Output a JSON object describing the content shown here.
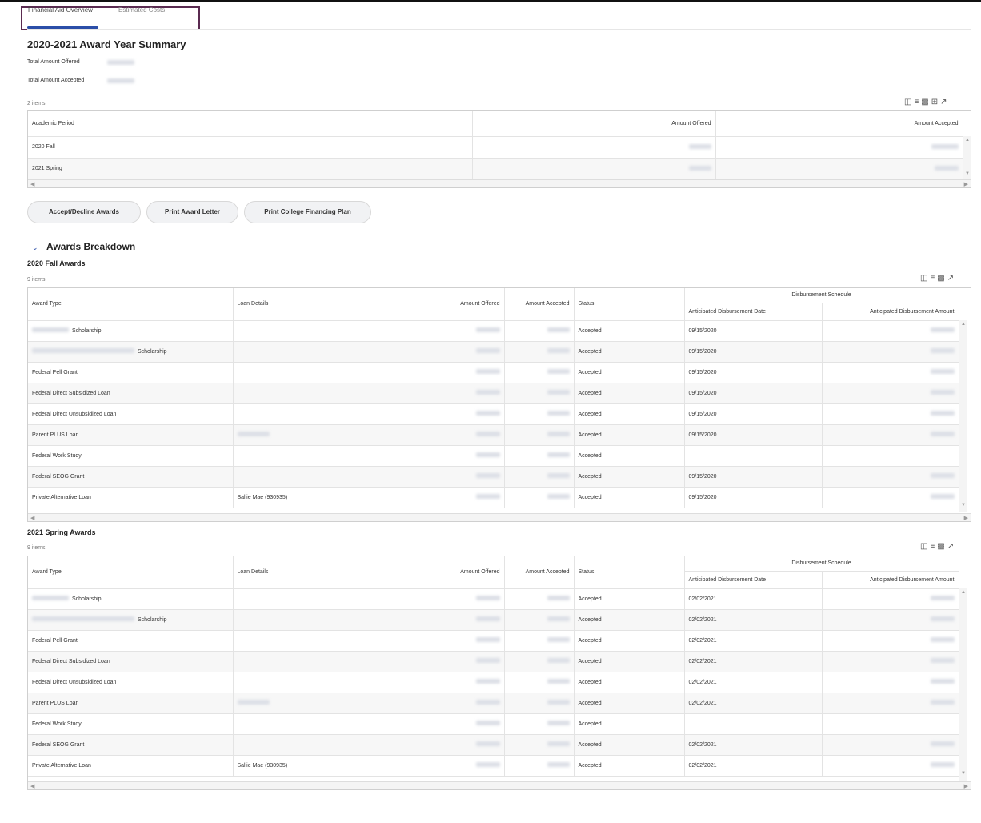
{
  "tabs": [
    "Financial Aid Overview",
    "Estimated Costs"
  ],
  "summary": {
    "title": "2020-2021 Award Year Summary",
    "total_offered_label": "Total Amount Offered",
    "total_accepted_label": "Total Amount Accepted"
  },
  "period_table": {
    "count": "2 items",
    "headers": [
      "Academic Period",
      "Amount Offered",
      "Amount Accepted"
    ],
    "rows": [
      {
        "period": "2020 Fall"
      },
      {
        "period": "2021 Spring"
      }
    ]
  },
  "buttons": {
    "accept": "Accept/Decline Awards",
    "letter": "Print Award Letter",
    "plan": "Print College Financing Plan"
  },
  "breakdown": {
    "title": "Awards Breakdown",
    "headers": {
      "award_type": "Award Type",
      "loan_details": "Loan Details",
      "amount_offered": "Amount Offered",
      "amount_accepted": "Amount Accepted",
      "status": "Status",
      "schedule": "Disbursement Schedule",
      "date": "Anticipated Disbursement Date",
      "amount": "Anticipated Disbursement Amount"
    },
    "fall": {
      "title": "2020 Fall Awards",
      "count": "9 items",
      "rows": [
        {
          "type": "Scholarship",
          "loan": "",
          "status": "Accepted",
          "date": "09/15/2020"
        },
        {
          "type": "Scholarship",
          "loan": "",
          "status": "Accepted",
          "date": "09/15/2020"
        },
        {
          "type": "Federal Pell Grant",
          "loan": "",
          "status": "Accepted",
          "date": "09/15/2020"
        },
        {
          "type": "Federal Direct Subsidized Loan",
          "loan": "",
          "status": "Accepted",
          "date": "09/15/2020"
        },
        {
          "type": "Federal Direct Unsubsidized Loan",
          "loan": "",
          "status": "Accepted",
          "date": "09/15/2020"
        },
        {
          "type": "Parent PLUS Loan",
          "loan": "",
          "status": "Accepted",
          "date": "09/15/2020"
        },
        {
          "type": "Federal Work Study",
          "loan": "",
          "status": "Accepted",
          "date": ""
        },
        {
          "type": "Federal SEOG Grant",
          "loan": "",
          "status": "Accepted",
          "date": "09/15/2020"
        },
        {
          "type": "Private Alternative Loan",
          "loan": "Sallie Mae (930935)",
          "status": "Accepted",
          "date": "09/15/2020"
        }
      ]
    },
    "spring": {
      "title": "2021 Spring Awards",
      "count": "9 items",
      "rows": [
        {
          "type": "Scholarship",
          "loan": "",
          "status": "Accepted",
          "date": "02/02/2021"
        },
        {
          "type": "Scholarship",
          "loan": "",
          "status": "Accepted",
          "date": "02/02/2021"
        },
        {
          "type": "Federal Pell Grant",
          "loan": "",
          "status": "Accepted",
          "date": "02/02/2021"
        },
        {
          "type": "Federal Direct Subsidized Loan",
          "loan": "",
          "status": "Accepted",
          "date": "02/02/2021"
        },
        {
          "type": "Federal Direct Unsubsidized Loan",
          "loan": "",
          "status": "Accepted",
          "date": "02/02/2021"
        },
        {
          "type": "Parent PLUS Loan",
          "loan": "",
          "status": "Accepted",
          "date": "02/02/2021"
        },
        {
          "type": "Federal Work Study",
          "loan": "",
          "status": "Accepted",
          "date": ""
        },
        {
          "type": "Federal SEOG Grant",
          "loan": "",
          "status": "Accepted",
          "date": "02/02/2021"
        },
        {
          "type": "Private Alternative Loan",
          "loan": "Sallie Mae (930935)",
          "status": "Accepted",
          "date": "02/02/2021"
        }
      ]
    }
  },
  "icons": [
    "columns-icon",
    "filter-icon",
    "chart-icon",
    "grid-icon",
    "fullscreen-icon"
  ],
  "colors": {
    "accent": "#2b4ea8",
    "tab_border": "#5a2a50"
  }
}
